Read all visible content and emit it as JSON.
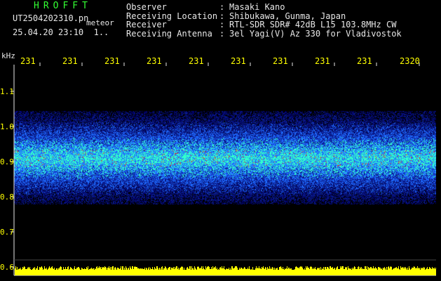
{
  "header": {
    "logo": "HROFFT",
    "filename": "UT2504202310.pn",
    "file_type": "meteor",
    "datetime": "25.04.20 23:10",
    "counter": "1..",
    "fields": [
      {
        "label": "Observer",
        "value": "Masaki Kano"
      },
      {
        "label": "Receiving Location",
        "value": "Shibukawa, Gunma, Japan"
      },
      {
        "label": "Receiver",
        "value": "RTL-SDR SDR# 42dB L15 103.8MHz CW"
      },
      {
        "label": "Receiving Antenna",
        "value": "3el Yagi(V) Az 330 for Vladivostok"
      }
    ],
    "separator": ":"
  },
  "axes": {
    "y_unit": "kHz",
    "y_ticks": [
      "1.1",
      "1.0",
      "0.9",
      "0.8",
      "0.7",
      "0.6"
    ],
    "x_ticks": [
      "231",
      "231",
      "231",
      "231",
      "231",
      "231",
      "231",
      "231",
      "231",
      "2320"
    ]
  },
  "colors": {
    "background": "#000000",
    "axis": "#e8e8e8",
    "tick_label": "#ffff00",
    "header_green": "#33ff33",
    "signal_low": "#0a1a8c",
    "signal_mid": "#1f6bff",
    "signal_high": "#33ffcc",
    "signal_peak": "#ff3300",
    "level_bar": "#ffff00"
  }
}
